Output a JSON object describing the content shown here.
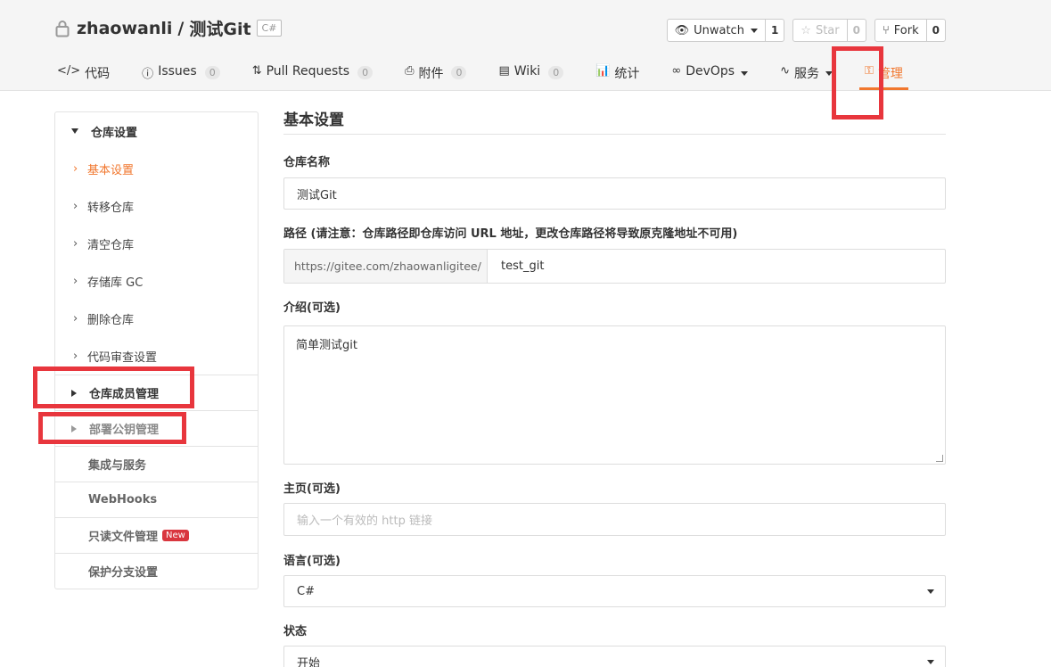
{
  "repo": {
    "owner": "zhaowanli",
    "separator": "/",
    "name": "测试Git",
    "lang": "C#"
  },
  "actions": {
    "watch": {
      "label": "Unwatch",
      "count": "1"
    },
    "star": {
      "label": "Star",
      "count": "0"
    },
    "fork": {
      "label": "Fork",
      "count": "0"
    }
  },
  "tabs": [
    {
      "icon": "</>",
      "label": "代码"
    },
    {
      "icon": "ⓘ",
      "label": "Issues",
      "count": "0"
    },
    {
      "icon": "⇅",
      "label": "Pull Requests",
      "count": "0"
    },
    {
      "icon": "⎙",
      "label": "附件",
      "count": "0"
    },
    {
      "icon": "▤",
      "label": "Wiki",
      "count": "0"
    },
    {
      "icon": "📊",
      "label": "统计"
    },
    {
      "icon": "∞",
      "label": "DevOps"
    },
    {
      "icon": "∿",
      "label": "服务"
    },
    {
      "icon": "⚿",
      "label": "管理"
    }
  ],
  "sidebar": {
    "group_title": "仓库设置",
    "sub_items": [
      "基本设置",
      "转移仓库",
      "清空仓库",
      "存储库 GC",
      "删除仓库",
      "代码审查设置"
    ],
    "rows": [
      "仓库成员管理",
      "部署公钥管理",
      "集成与服务",
      "WebHooks",
      "只读文件管理",
      "保护分支设置"
    ],
    "new_badge": "New"
  },
  "main": {
    "title": "基本设置",
    "repo_name_label": "仓库名称",
    "repo_name_value": "测试Git",
    "path_label": "路径 (请注意：仓库路径即仓库访问 URL 地址，更改仓库路径将导致原克隆地址不可用)",
    "path_prefix": "https://gitee.com/zhaowanligitee/",
    "path_value": "test_git",
    "intro_label": "介绍(可选)",
    "intro_value": "简单测试git",
    "homepage_label": "主页(可选)",
    "homepage_placeholder": "输入一个有效的 http 链接",
    "language_label": "语言(可选)",
    "language_value": "C#",
    "status_label": "状态",
    "status_value": "开始"
  },
  "colors": {
    "accent": "#f1772e",
    "highlight": "#e8363d",
    "new_badge": "#d9363e"
  }
}
